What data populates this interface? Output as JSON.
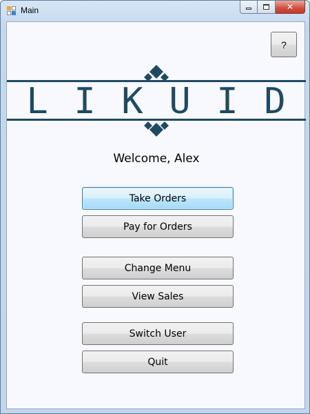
{
  "window": {
    "title": "Main",
    "close_glyph": "✕"
  },
  "help_button": {
    "label": "?"
  },
  "logo": {
    "letters": [
      "L",
      "I",
      "K",
      "U",
      "I",
      "D"
    ],
    "color": "#1f4a63"
  },
  "welcome_text": "Welcome, Alex",
  "buttons": {
    "take_orders": "Take Orders",
    "pay_for_orders": "Pay for Orders",
    "change_menu": "Change Menu",
    "view_sales": "View Sales",
    "switch_user": "Switch User",
    "quit": "Quit"
  }
}
